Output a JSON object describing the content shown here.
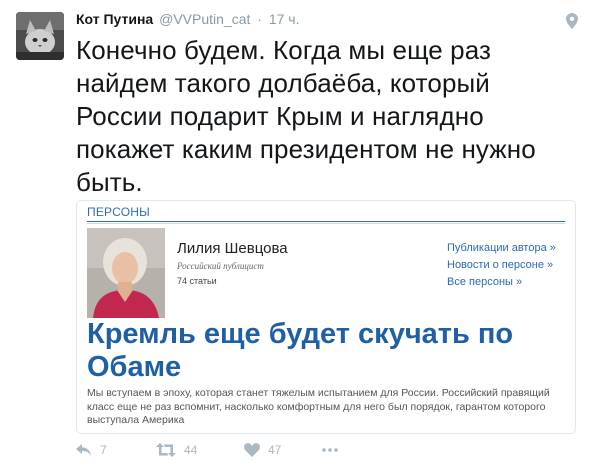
{
  "tweet": {
    "author_name": "Кот Путина",
    "author_handle": "@VVPutin_cat",
    "separator": "·",
    "time": "17 ч.",
    "text": "Конечно будем. Когда мы еще раз найдем такого долбаёба, который России подарит Крым и наглядно покажет каким президентом не нужно быть."
  },
  "card": {
    "section": "ПЕРСОНЫ",
    "person_name": "Лилия Шевцова",
    "person_role": "Российский публицист",
    "person_count": "74 статьи",
    "links": [
      "Публикации автора »",
      "Новости о персоне »",
      "Все персоны »"
    ],
    "headline": "Кремль еще будет скучать по Обаме",
    "lede": "Мы вступаем в эпоху, которая станет тяжелым испытанием для России. Российский правящий класс еще не раз вспомнит, насколько комфортным для него был порядок, гарантом которого выступала Америка"
  },
  "actions": {
    "reply_count": "7",
    "retweet_count": "44",
    "like_count": "47"
  },
  "icons": {
    "avatar": "cat-avatar",
    "geo": "location-pin-icon",
    "reply": "reply-icon",
    "retweet": "retweet-icon",
    "like": "heart-icon",
    "more": "more-dots-icon"
  },
  "colors": {
    "icon_gray": "#aab8c2",
    "card_blue": "#1f5fa6",
    "photo_shirt": "#c2274f"
  }
}
